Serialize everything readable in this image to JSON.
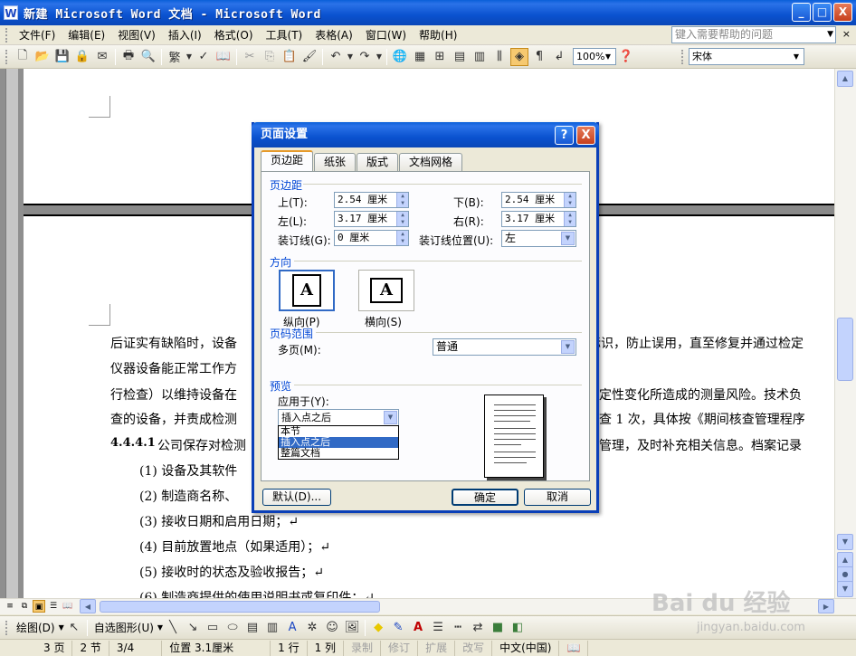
{
  "window": {
    "title": "新建 Microsoft Word 文档 - Microsoft Word",
    "app_icon": "W",
    "minimize_glyph": "_",
    "maximize_glyph": "□",
    "close_glyph": "X"
  },
  "menu": {
    "items": [
      "文件(F)",
      "编辑(E)",
      "视图(V)",
      "插入(I)",
      "格式(O)",
      "工具(T)",
      "表格(A)",
      "窗口(W)",
      "帮助(H)"
    ],
    "help_placeholder": "键入需要帮助的问题",
    "close_glyph": "×"
  },
  "toolbar": {
    "zoom": "100%",
    "font": "宋体",
    "char_glyph": "繁"
  },
  "document": {
    "lines": [
      "后证实有缺陷时，设备",
      "仪器设备能正常工作方",
      "行检查）以维持设备在",
      "查的设备，并责成检测"
    ],
    "lines_right": [
      "用标识，防止误用，直至修复并通过检定",
      "",
      "定性变化所造成的测量风险。技术负",
      "核查 1 次，具体按《期间核查管理程序"
    ],
    "heading_num": "4.4.4.1",
    "heading_text": "公司保存对检测",
    "heading_right": "态管理，及时补充相关信息。档案记录",
    "list": [
      "(1)  设备及其软件",
      "(2)  制造商名称、",
      "(3)  接收日期和启用日期；↵",
      "(4)  目前放置地点（如果适用）；↵",
      "(5)  接收时的状态及验收报告；↵",
      "(6)  制造商提供的使用说明书或复印件；↵"
    ]
  },
  "dialog": {
    "title": "页面设置",
    "help_glyph": "?",
    "close_glyph": "X",
    "tabs": [
      "页边距",
      "纸张",
      "版式",
      "文档网格"
    ],
    "margins_group": "页边距",
    "top_label": "上(T):",
    "top_value": "2.54 厘米",
    "bottom_label": "下(B):",
    "bottom_value": "2.54 厘米",
    "left_label": "左(L):",
    "left_value": "3.17 厘米",
    "right_label": "右(R):",
    "right_value": "3.17 厘米",
    "gutter_label": "装订线(G):",
    "gutter_value": "0 厘米",
    "gutter_pos_label": "装订线位置(U):",
    "gutter_pos_value": "左",
    "orientation_group": "方向",
    "portrait_label": "纵向(P)",
    "landscape_label": "横向(S)",
    "page_icon_glyph": "A",
    "pages_group": "页码范围",
    "multi_pages_label": "多页(M):",
    "multi_pages_value": "普通",
    "preview_group": "预览",
    "apply_to_label": "应用于(Y):",
    "apply_to_value": "插入点之后",
    "apply_options": [
      "本节",
      "插入点之后",
      "整篇文档"
    ],
    "default_button": "默认(D)...",
    "ok_button": "确定",
    "cancel_button": "取消"
  },
  "drawing": {
    "draw_label": "绘图(D)",
    "autoshapes_label": "自选图形(U)"
  },
  "status": {
    "page": "3 页",
    "section": "2 节",
    "pages": "3/4",
    "position": "位置 3.1厘米",
    "line": "1 行",
    "column": "1 列",
    "rec": "录制",
    "trk": "修订",
    "ext": "扩展",
    "ovr": "改写",
    "lang": "中文(中国)"
  },
  "watermark": {
    "brand": "Bai du 经验",
    "url": "jingyan.baidu.com"
  }
}
